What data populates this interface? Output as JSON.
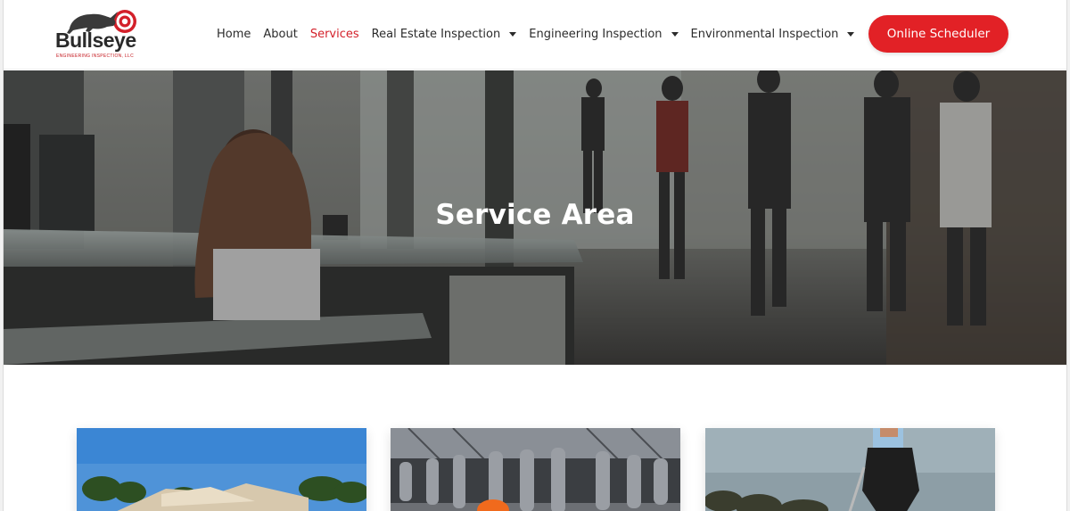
{
  "brand": {
    "name": "Bullseye",
    "tagline": "ENGINEERING INSPECTION, LLC",
    "accent": "#e22126"
  },
  "nav": {
    "items": [
      {
        "label": "Home",
        "active": false,
        "dropdown": false
      },
      {
        "label": "About",
        "active": false,
        "dropdown": false
      },
      {
        "label": "Services",
        "active": true,
        "dropdown": false
      },
      {
        "label": "Real Estate Inspection",
        "active": false,
        "dropdown": true
      },
      {
        "label": "Engineering Inspection",
        "active": false,
        "dropdown": true
      },
      {
        "label": "Environmental Inspection",
        "active": false,
        "dropdown": true
      }
    ],
    "cta_label": "Online Scheduler"
  },
  "hero": {
    "title": "Service Area"
  },
  "cards": [
    {
      "image": "house-photo"
    },
    {
      "image": "machinery-photo"
    },
    {
      "image": "shoreline-photo"
    }
  ]
}
